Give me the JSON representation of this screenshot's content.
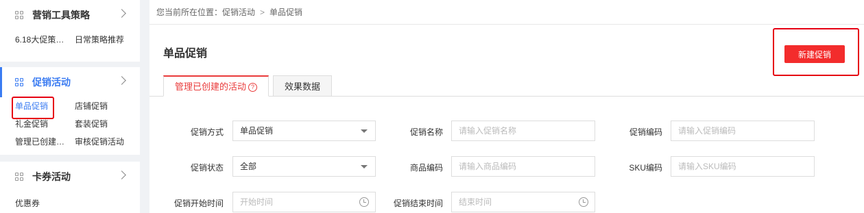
{
  "sidebar": {
    "groups": [
      {
        "title": "营销工具策略",
        "items": [
          "6.18大促策…",
          "日常策略推荐"
        ]
      },
      {
        "title": "促销活动",
        "items": [
          "单品促销",
          "店铺促销",
          "礼金促销",
          "套装促销",
          "管理已创建…",
          "审核促销活动"
        ]
      },
      {
        "title": "卡券活动",
        "items": [
          "优惠券"
        ]
      }
    ]
  },
  "breadcrumb": {
    "prefix": "您当前所在位置：",
    "level1": "促销活动",
    "level2": "单品促销",
    "sep": ">"
  },
  "page": {
    "title": "单品促销",
    "new_button": "新建促销"
  },
  "tabs": [
    {
      "label": "管理已创建的活动",
      "help": "?"
    },
    {
      "label": "效果数据"
    }
  ],
  "form": {
    "promo_method": {
      "label": "促销方式",
      "value": "单品促销"
    },
    "promo_name": {
      "label": "促销名称",
      "placeholder": "请输入促销名称"
    },
    "promo_code": {
      "label": "促销编码",
      "placeholder": "请输入促销编码"
    },
    "promo_status": {
      "label": "促销状态",
      "value": "全部"
    },
    "product_code": {
      "label": "商品编码",
      "placeholder": "请输入商品编码"
    },
    "sku_code": {
      "label": "SKU编码",
      "placeholder": "请输入SKU编码"
    },
    "start_time": {
      "label": "促销开始时间",
      "placeholder": "开始时间"
    },
    "end_time": {
      "label": "促销结束时间",
      "placeholder": "结束时间"
    }
  },
  "colors": {
    "accent": "#3b7cf2",
    "primary_red": "#f32c2c",
    "highlight_box": "#e60012"
  }
}
